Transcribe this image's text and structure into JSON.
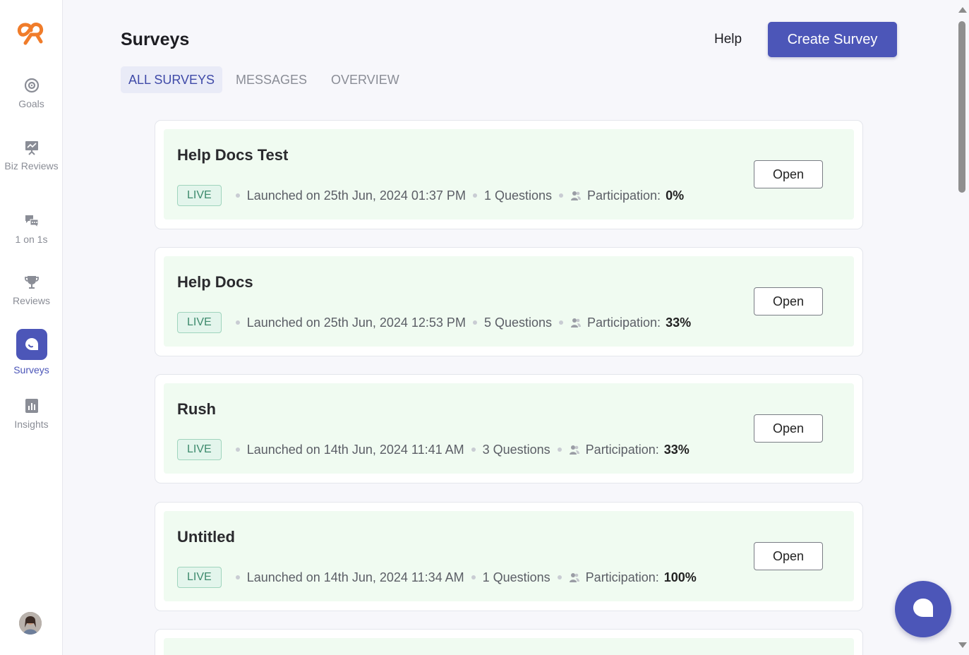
{
  "sidebar": {
    "items": [
      {
        "label": "Goals",
        "icon": "target-icon"
      },
      {
        "label": "Biz Reviews",
        "icon": "presentation-icon"
      },
      {
        "label": "1 on 1s",
        "icon": "chat-bubbles-icon"
      },
      {
        "label": "Reviews",
        "icon": "trophy-icon"
      },
      {
        "label": "Surveys",
        "icon": "survey-icon",
        "active": true
      },
      {
        "label": "Insights",
        "icon": "bar-chart-icon"
      }
    ]
  },
  "header": {
    "title": "Surveys",
    "help_label": "Help",
    "create_label": "Create Survey"
  },
  "tabs": [
    {
      "label": "ALL SURVEYS",
      "active": true
    },
    {
      "label": "MESSAGES"
    },
    {
      "label": "OVERVIEW"
    }
  ],
  "surveys": [
    {
      "title": "Help Docs Test",
      "status": "LIVE",
      "launched": "Launched on 25th Jun, 2024 01:37 PM",
      "questions": "1 Questions",
      "participation_label": "Participation:",
      "participation_value": "0%",
      "action": "Open"
    },
    {
      "title": "Help Docs",
      "status": "LIVE",
      "launched": "Launched on 25th Jun, 2024 12:53 PM",
      "questions": "5 Questions",
      "participation_label": "Participation:",
      "participation_value": "33%",
      "action": "Open"
    },
    {
      "title": "Rush",
      "status": "LIVE",
      "launched": "Launched on 14th Jun, 2024 11:41 AM",
      "questions": "3 Questions",
      "participation_label": "Participation:",
      "participation_value": "33%",
      "action": "Open"
    },
    {
      "title": "Untitled",
      "status": "LIVE",
      "launched": "Launched on 14th Jun, 2024 11:34 AM",
      "questions": "1 Questions",
      "participation_label": "Participation:",
      "participation_value": "100%",
      "action": "Open"
    }
  ],
  "colors": {
    "accent": "#4c56b8",
    "card_bg": "#f0fbf1",
    "live_badge": "#3d8a6d",
    "logo": "#f07c2a"
  }
}
